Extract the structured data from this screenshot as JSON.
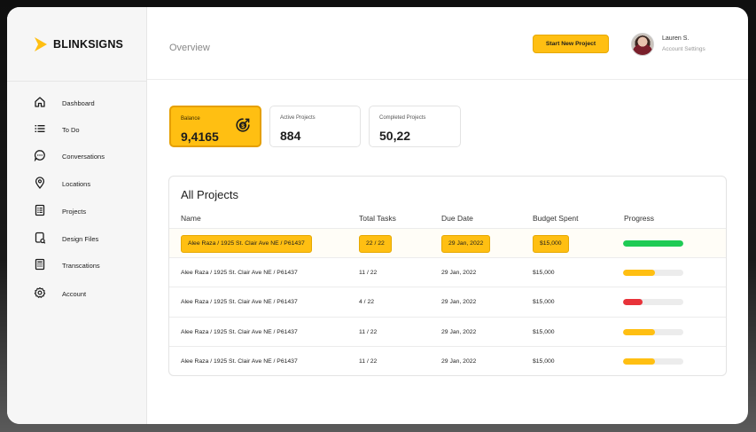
{
  "brand": {
    "name": "BLINKSIGNS",
    "accent": "#FFBF12"
  },
  "sidebar": {
    "items": [
      {
        "label": "Dashboard",
        "icon": "home-icon"
      },
      {
        "label": "To Do",
        "icon": "list-icon"
      },
      {
        "label": "Conversations",
        "icon": "chat-icon"
      },
      {
        "label": "Locations",
        "icon": "location-pin-icon"
      },
      {
        "label": "Projects",
        "icon": "projects-icon"
      },
      {
        "label": "Design Files",
        "icon": "design-files-icon"
      },
      {
        "label": "Transcations",
        "icon": "receipt-icon"
      },
      {
        "label": "Account",
        "icon": "gear-icon"
      }
    ]
  },
  "header": {
    "title": "Overview",
    "cta_label": "Start New Project",
    "user": {
      "name": "Lauren S.",
      "subtitle": "Account Settings"
    }
  },
  "stats": [
    {
      "label": "Balance",
      "value": "9,4165",
      "icon": "dollar-coin-icon"
    },
    {
      "label": "Active Projects",
      "value": "884"
    },
    {
      "label": "Completed Projects",
      "value": "50,22"
    }
  ],
  "projects": {
    "title": "All Projects",
    "columns": [
      "Name",
      "Total Tasks",
      "Due Date",
      "Budget Spent",
      "Progress"
    ],
    "rows": [
      {
        "name": "Alee Raza / 1925 St. Clair Ave NE / P61437",
        "tasks": "22 / 22",
        "due": "29 Jan, 2022",
        "budget": "$15,000",
        "progress": 1.0,
        "status_color": "#1FCB55",
        "highlighted": true
      },
      {
        "name": "Alee Raza / 1925 St. Clair Ave NE / P61437",
        "tasks": "11 / 22",
        "due": "29 Jan, 2022",
        "budget": "$15,000",
        "progress": 0.53,
        "status_color": "#FFBF12",
        "highlighted": false
      },
      {
        "name": "Alee Raza / 1925 St. Clair Ave NE / P61437",
        "tasks": "4 / 22",
        "due": "29 Jan, 2022",
        "budget": "$15,000",
        "progress": 0.32,
        "status_color": "#E8333A",
        "highlighted": false
      },
      {
        "name": "Alee Raza / 1925 St. Clair Ave NE / P61437",
        "tasks": "11 / 22",
        "due": "29 Jan, 2022",
        "budget": "$15,000",
        "progress": 0.53,
        "status_color": "#FFBF12",
        "highlighted": false
      },
      {
        "name": "Alee Raza / 1925 St. Clair Ave NE / P61437",
        "tasks": "11 / 22",
        "due": "29 Jan, 2022",
        "budget": "$15,000",
        "progress": 0.53,
        "status_color": "#FFBF12",
        "highlighted": false
      }
    ]
  }
}
